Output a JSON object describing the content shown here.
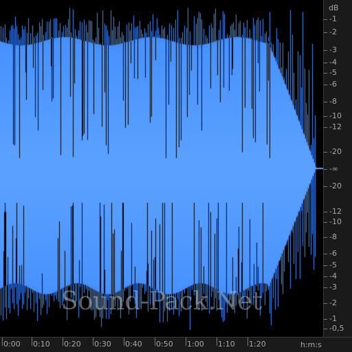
{
  "waveform": {
    "color": "#3f8cff",
    "color_light": "#5aa0ff",
    "background": "#000000"
  },
  "watermark": {
    "text": "Sound-Pack.Net"
  },
  "db_ruler": {
    "unit": "dB",
    "labels": [
      "-1",
      "-2",
      "-3",
      "-4",
      "-5",
      "-6",
      "-8",
      "-10",
      "-12",
      "-20",
      "-∞",
      "-20",
      "-12",
      "-10",
      "-8",
      "-6",
      "-5",
      "-4",
      "-3",
      "-2",
      "-1",
      "-0,5"
    ]
  },
  "time_ruler": {
    "unit": "h:m:s",
    "labels": [
      "0:00",
      "0:10",
      "0:20",
      "0:30",
      "0:40",
      "0:50",
      "1:00",
      "1:10",
      "1:20"
    ]
  }
}
